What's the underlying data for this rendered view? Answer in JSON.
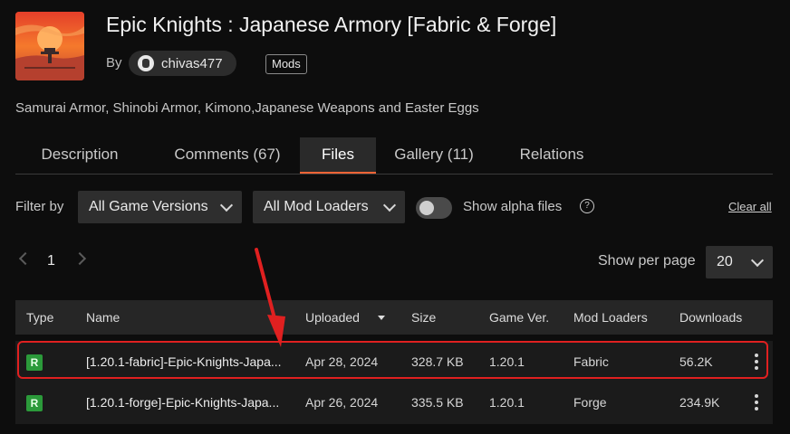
{
  "header": {
    "title": "Epic Knights : Japanese Armory [Fabric & Forge]",
    "by_label": "By",
    "author": "chivas477",
    "tag": "Mods",
    "summary": "Samurai Armor, Shinobi Armor, Kimono,Japanese Weapons and Easter Eggs"
  },
  "tabs": [
    {
      "label": "Description",
      "active": false
    },
    {
      "label": "Comments (67)",
      "active": false
    },
    {
      "label": "Files",
      "active": true
    },
    {
      "label": "Gallery (11)",
      "active": false
    },
    {
      "label": "Relations",
      "active": false
    }
  ],
  "filters": {
    "label": "Filter by",
    "game_versions": "All Game Versions",
    "mod_loaders": "All Mod Loaders",
    "alpha_label": "Show alpha files",
    "alpha_enabled": false,
    "help_glyph": "?",
    "clear_all": "Clear all"
  },
  "pagination": {
    "current_page": "1",
    "per_page_label": "Show per page",
    "per_page_value": "20"
  },
  "table": {
    "columns": [
      "Type",
      "Name",
      "Uploaded",
      "Size",
      "Game Ver.",
      "Mod Loaders",
      "Downloads"
    ],
    "sorted_column": "Uploaded",
    "rows": [
      {
        "type": "R",
        "name": "[1.20.1-fabric]-Epic-Knights-Japa...",
        "uploaded": "Apr 28, 2024",
        "size": "328.7 KB",
        "game_ver": "1.20.1",
        "loader": "Fabric",
        "downloads": "56.2K",
        "highlighted": true
      },
      {
        "type": "R",
        "name": "[1.20.1-forge]-Epic-Knights-Japa...",
        "uploaded": "Apr 26, 2024",
        "size": "335.5 KB",
        "game_ver": "1.20.1",
        "loader": "Forge",
        "downloads": "234.9K",
        "highlighted": false
      }
    ]
  },
  "colors": {
    "accent": "#f16436",
    "release_badge": "#2b9a3a",
    "highlight": "#e02020"
  },
  "icons": {
    "sort": "caret-down-icon",
    "help": "question-circle-icon",
    "row_menu": "kebab-menu-icon",
    "annotation": "red-arrow-icon"
  }
}
